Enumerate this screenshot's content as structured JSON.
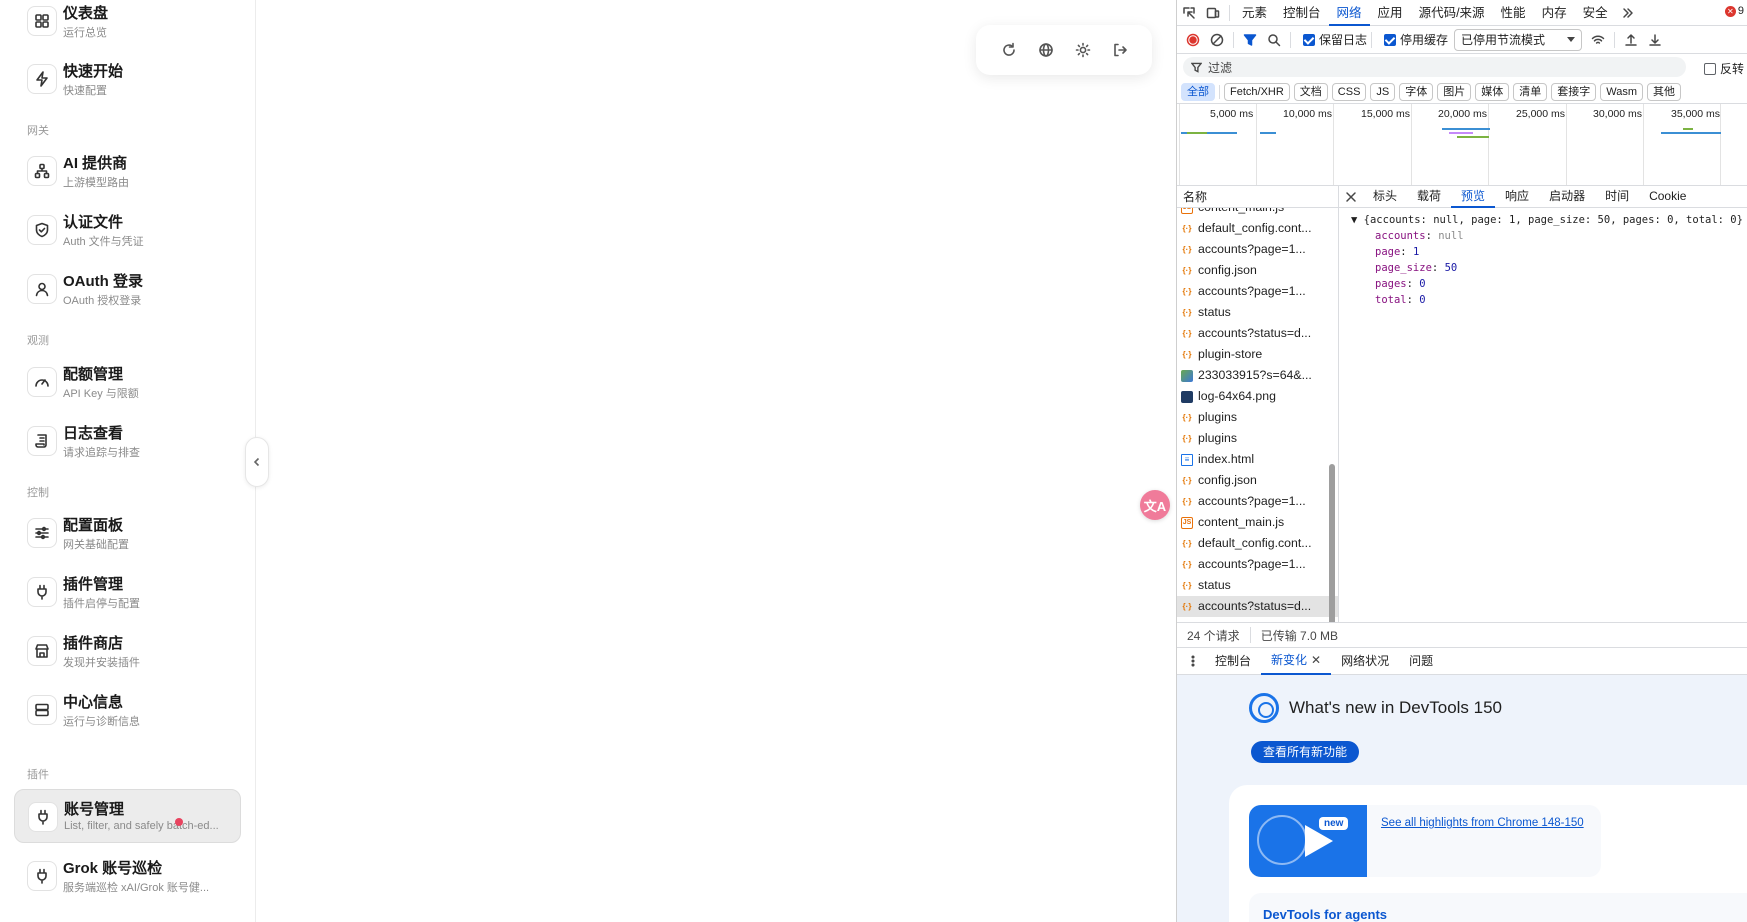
{
  "sidebar": {
    "sections": {
      "gateway": "网关",
      "observe": "观测",
      "control": "控制",
      "plugins": "插件"
    },
    "items": [
      {
        "title": "仪表盘",
        "sub": "运行总览",
        "icon": "dashboard-icon"
      },
      {
        "title": "快速开始",
        "sub": "快速配置",
        "icon": "lightning-icon"
      },
      {
        "title": "AI 提供商",
        "sub": "上游模型路由",
        "icon": "network-icon"
      },
      {
        "title": "认证文件",
        "sub": "Auth 文件与凭证",
        "icon": "shield-icon"
      },
      {
        "title": "OAuth 登录",
        "sub": "OAuth 授权登录",
        "icon": "user-icon"
      },
      {
        "title": "配额管理",
        "sub": "API Key 与限额",
        "icon": "gauge-icon"
      },
      {
        "title": "日志查看",
        "sub": "请求追踪与排查",
        "icon": "scroll-icon"
      },
      {
        "title": "配置面板",
        "sub": "网关基础配置",
        "icon": "sliders-icon"
      },
      {
        "title": "插件管理",
        "sub": "插件启停与配置",
        "icon": "plug-icon"
      },
      {
        "title": "插件商店",
        "sub": "发现并安装插件",
        "icon": "store-icon"
      },
      {
        "title": "中心信息",
        "sub": "运行与诊断信息",
        "icon": "server-icon"
      },
      {
        "title": "账号管理",
        "sub": "List, filter, and safely batch-ed...",
        "icon": "plug-icon"
      },
      {
        "title": "Grok 账号巡检",
        "sub": "服务端巡检 xAI/Grok 账号健...",
        "icon": "plug-icon"
      }
    ]
  },
  "floating_toolbar": {
    "icons": [
      "refresh-icon",
      "globe-icon",
      "sun-icon",
      "logout-icon"
    ]
  },
  "translate_bubble": "文A",
  "devtools": {
    "tabs": [
      "元素",
      "控制台",
      "网络",
      "应用",
      "源代码/来源",
      "性能",
      "内存",
      "安全"
    ],
    "active_tab": "网络",
    "error_count": "9",
    "toolbar": {
      "preserve_log": "保留日志",
      "disable_cache": "停用缓存",
      "throttle": "已停用节流模式"
    },
    "filter": {
      "placeholder": "过滤",
      "invert": "反转"
    },
    "types": [
      "全部",
      "Fetch/XHR",
      "文档",
      "CSS",
      "JS",
      "字体",
      "图片",
      "媒体",
      "清单",
      "套接字",
      "Wasm",
      "其他"
    ],
    "timeline_labels": [
      "5,000 ms",
      "10,000 ms",
      "15,000 ms",
      "20,000 ms",
      "25,000 ms",
      "30,000 ms",
      "35,000 ms"
    ],
    "list_header": "名称",
    "requests": [
      {
        "name": "content_main.js",
        "type": "js"
      },
      {
        "name": "default_config.cont...",
        "type": "xhr"
      },
      {
        "name": "accounts?page=1...",
        "type": "xhr"
      },
      {
        "name": "config.json",
        "type": "xhr"
      },
      {
        "name": "accounts?page=1...",
        "type": "xhr"
      },
      {
        "name": "status",
        "type": "xhr"
      },
      {
        "name": "accounts?status=d...",
        "type": "xhr"
      },
      {
        "name": "plugin-store",
        "type": "xhr"
      },
      {
        "name": "233033915?s=64&...",
        "type": "img"
      },
      {
        "name": "log-64x64.png",
        "type": "png"
      },
      {
        "name": "plugins",
        "type": "xhr"
      },
      {
        "name": "plugins",
        "type": "xhr"
      },
      {
        "name": "index.html",
        "type": "doc"
      },
      {
        "name": "config.json",
        "type": "xhr"
      },
      {
        "name": "accounts?page=1...",
        "type": "xhr"
      },
      {
        "name": "content_main.js",
        "type": "js"
      },
      {
        "name": "default_config.cont...",
        "type": "xhr"
      },
      {
        "name": "accounts?page=1...",
        "type": "xhr"
      },
      {
        "name": "status",
        "type": "xhr"
      },
      {
        "name": "accounts?status=d...",
        "type": "xhr"
      }
    ],
    "detail_tabs": [
      "标头",
      "载荷",
      "预览",
      "响应",
      "启动器",
      "时间",
      "Cookie"
    ],
    "active_detail_tab": "预览",
    "preview": {
      "summary": "{accounts: null, page: 1, page_size: 50, pages: 0, total: 0}",
      "fields": [
        {
          "key": "accounts",
          "value": "null",
          "kind": "null"
        },
        {
          "key": "page",
          "value": "1",
          "kind": "num"
        },
        {
          "key": "page_size",
          "value": "50",
          "kind": "num"
        },
        {
          "key": "pages",
          "value": "0",
          "kind": "num"
        },
        {
          "key": "total",
          "value": "0",
          "kind": "num"
        }
      ]
    },
    "footer": {
      "requests": "24 个请求",
      "transferred": "已传输 7.0 MB"
    },
    "drawer_tabs": [
      "控制台",
      "新变化",
      "网络状况",
      "问题"
    ],
    "active_drawer_tab": "新变化",
    "whats_new": {
      "title": "What's new in DevTools 150",
      "button": "查看所有新功能",
      "badge": "new",
      "highlight_link": "See all highlights from Chrome 148-150",
      "next_title": "DevTools for agents"
    }
  }
}
